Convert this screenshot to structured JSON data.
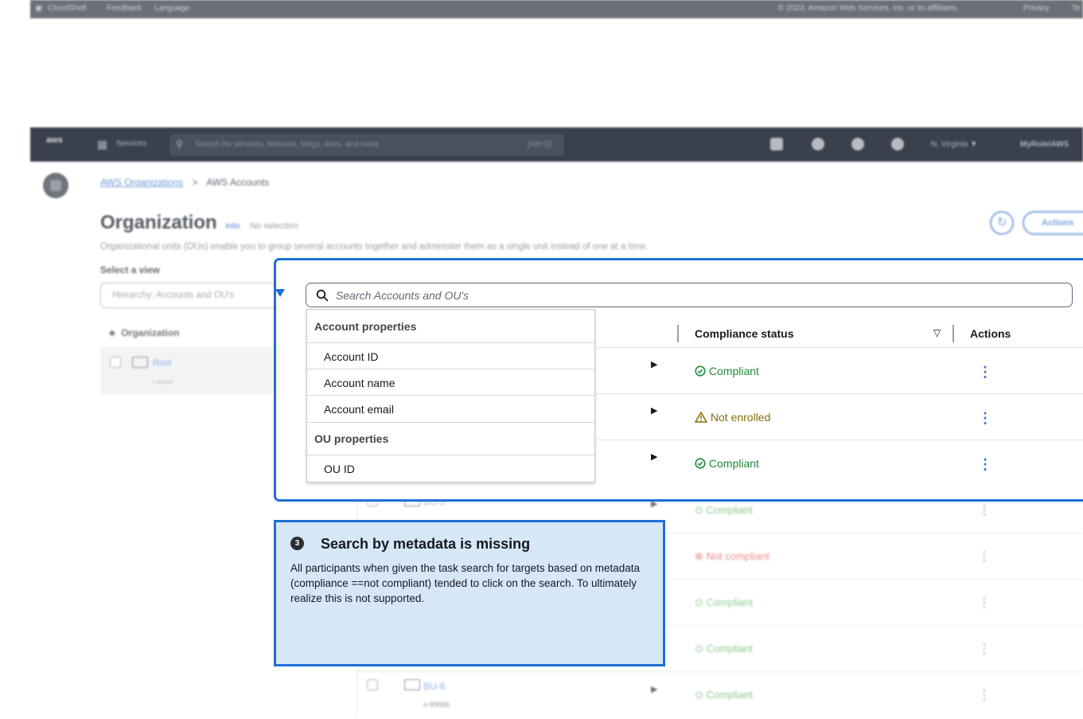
{
  "footer": {
    "cloudshell": "CloudShell",
    "feedback": "Feedback",
    "language": "Language",
    "copyright": "© 2023, Amazon Web Services, Inc. or its affiliates.",
    "privacy": "Privacy",
    "terms": "Te"
  },
  "nav": {
    "logo": "aws",
    "services": "Services",
    "search_placeholder": "Search for services, features, blogs, docs, and more",
    "shortcut": "[Alt+S]",
    "region": "N. Virginia ▼",
    "role": "MyRole/AWS"
  },
  "breadcrumb": {
    "root": "AWS Organizations",
    "sep": ">",
    "current": "AWS Accounts"
  },
  "page": {
    "title": "Organization",
    "info": "Info",
    "selection": "No selection",
    "description": "Organizational units (OUs) enable you to group several accounts together and administer them as a single unit instead of one at a time.",
    "actions": "Actions"
  },
  "view": {
    "label": "Select a view",
    "value": "Hierarchy: Accounts and OU's"
  },
  "tree": {
    "header": "Organization",
    "root_name": "Root",
    "root_id": "r-xxxxx"
  },
  "search": {
    "placeholder": "Search Accounts and OU's"
  },
  "dropdown": {
    "group1": "Account properties",
    "items1": [
      "Account ID",
      "Account name",
      "Account email"
    ],
    "group2": "OU properties",
    "items2": [
      "OU ID"
    ]
  },
  "table": {
    "col_compliance": "Compliance status",
    "col_actions": "Actions",
    "rows": [
      {
        "status": "Compliant",
        "kind": "ok"
      },
      {
        "status": "Not enrolled",
        "kind": "warn"
      },
      {
        "status": "Compliant",
        "kind": "ok"
      },
      {
        "name": "BU-3",
        "status": "Compliant",
        "kind": "ok"
      },
      {
        "status": "Not compliant",
        "kind": "bad"
      },
      {
        "status": "Compliant",
        "kind": "ok"
      },
      {
        "status": "Compliant",
        "kind": "ok"
      },
      {
        "name": "BU-6",
        "id": "o-99006",
        "status": "Compliant",
        "kind": "ok"
      }
    ]
  },
  "callout": {
    "number": "3",
    "title": "Search by metadata is missing",
    "body": "All participants when given the task search for targets based on metadata (compliance ==not compliant) tended to click on the search. To ultimately realize this is not supported."
  },
  "colors": {
    "accent": "#1f6fd6",
    "ok": "#1f8c3b",
    "warn": "#8a6d0b",
    "bad": "#d13212",
    "callout_bg": "#d6e7f8"
  }
}
